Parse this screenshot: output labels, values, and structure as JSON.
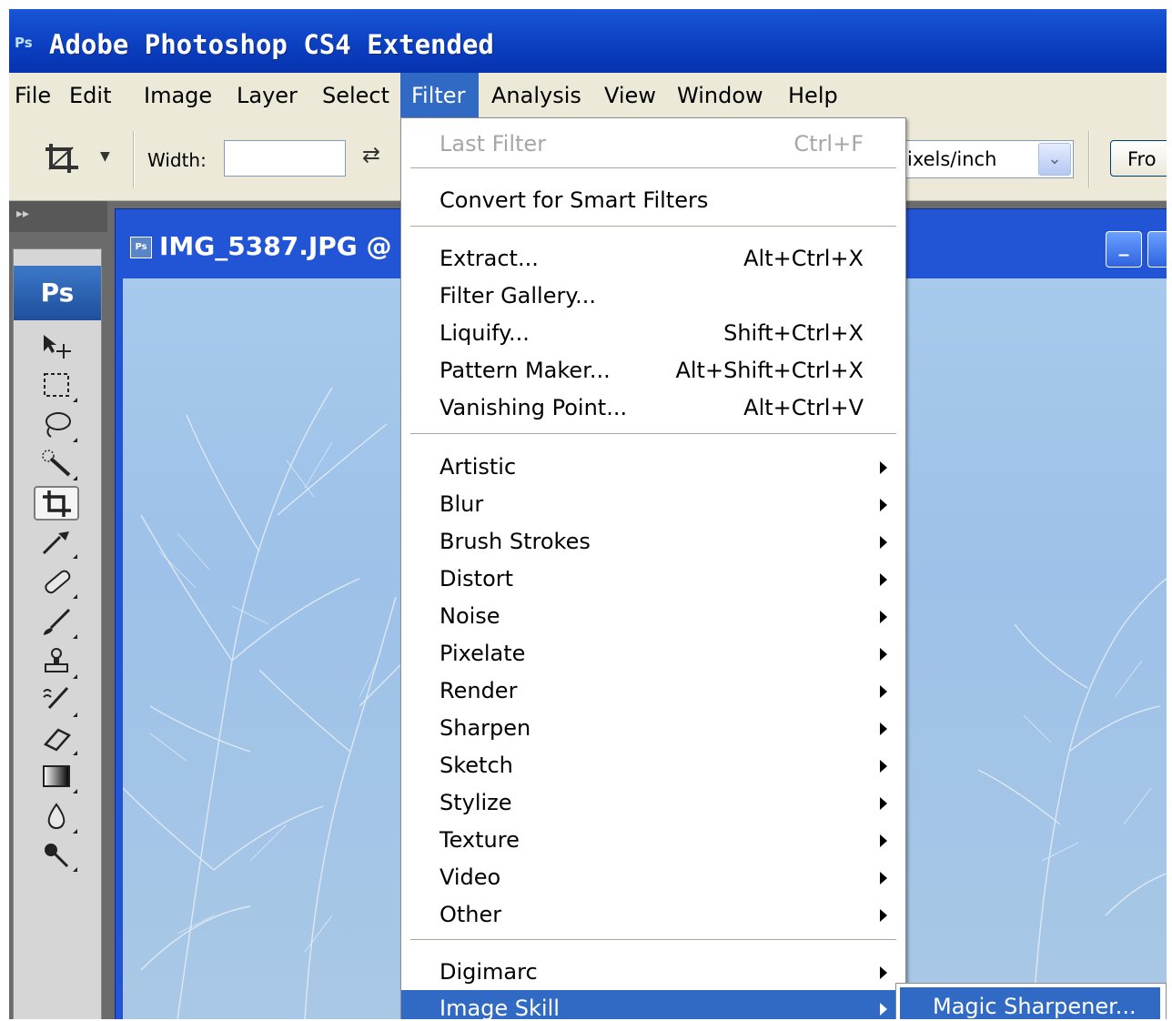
{
  "app": {
    "badge": "Ps",
    "title": "Adobe Photoshop CS4 Extended"
  },
  "menubar": {
    "items": [
      "File",
      "Edit",
      "Image",
      "Layer",
      "Select",
      "Filter",
      "Analysis",
      "View",
      "Window",
      "Help"
    ],
    "active": "Filter"
  },
  "options": {
    "width_label": "Width:",
    "width_value": "",
    "resolution_unit": "ixels/inch",
    "front_button": "Fro"
  },
  "document": {
    "title": "IMG_5387.JPG @",
    "icon_text": "Ps"
  },
  "toolbox": {
    "logo": "Ps",
    "tools": [
      "move-tool-icon",
      "marquee-tool-icon",
      "lasso-tool-icon",
      "quick-selection-tool-icon",
      "crop-tool-icon",
      "eyedropper-tool-icon",
      "healing-brush-tool-icon",
      "brush-tool-icon",
      "clone-stamp-tool-icon",
      "history-brush-tool-icon",
      "eraser-tool-icon",
      "gradient-tool-icon",
      "blur-tool-icon",
      "dodge-tool-icon"
    ],
    "selected_tool": "crop-tool-icon"
  },
  "filter_menu": {
    "last_filter": {
      "label": "Last Filter",
      "shortcut": "Ctrl+F"
    },
    "convert": {
      "label": "Convert for Smart Filters"
    },
    "extract": {
      "label": "Extract...",
      "shortcut": "Alt+Ctrl+X"
    },
    "filter_gallery": {
      "label": "Filter Gallery..."
    },
    "liquify": {
      "label": "Liquify...",
      "shortcut": "Shift+Ctrl+X"
    },
    "pattern_maker": {
      "label": "Pattern Maker...",
      "shortcut": "Alt+Shift+Ctrl+X"
    },
    "vanishing_point": {
      "label": "Vanishing Point...",
      "shortcut": "Alt+Ctrl+V"
    },
    "categories": [
      "Artistic",
      "Blur",
      "Brush Strokes",
      "Distort",
      "Noise",
      "Pixelate",
      "Render",
      "Sharpen",
      "Sketch",
      "Stylize",
      "Texture",
      "Video",
      "Other"
    ],
    "plugins": [
      "Digimarc",
      "Image Skill"
    ],
    "highlighted": "Image Skill"
  },
  "submenu": {
    "items": [
      "Magic Sharpener..."
    ]
  },
  "colors": {
    "title_bar": "#0a3ebf",
    "menu_highlight": "#316ac5",
    "menu_background": "#ece9d8",
    "sky": "#a7c9ec"
  }
}
